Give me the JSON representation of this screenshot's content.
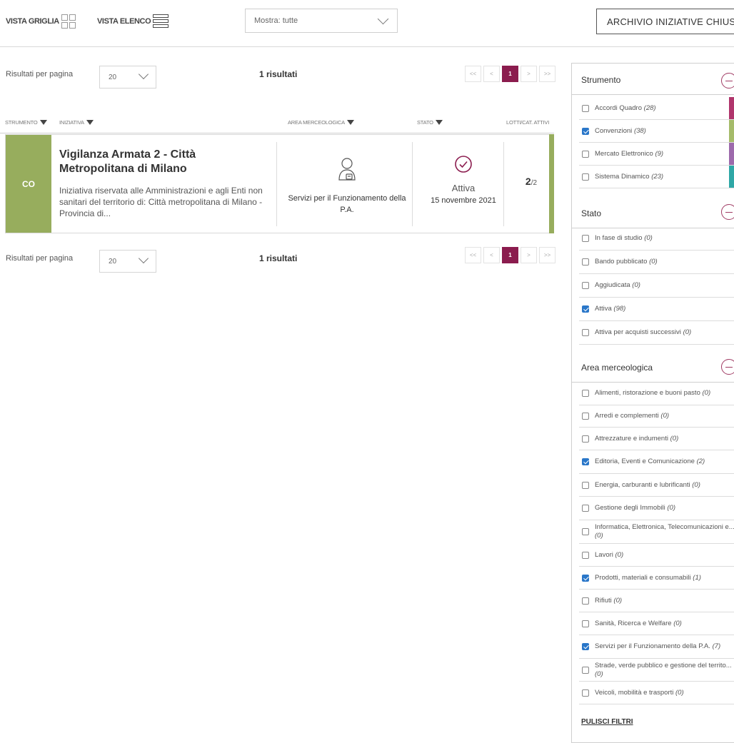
{
  "toolbar": {
    "grid_view_label": "VISTA GRIGLIA",
    "list_view_label": "VISTA ELENCO",
    "show_filter": "Mostra: tutte",
    "archive_button": "ARCHIVIO INIZIATIVE CHIUSE"
  },
  "pagination": {
    "per_page_label": "Risultati per pagina",
    "per_page_value": "20",
    "results_count": "1 risultati",
    "first": "<<",
    "prev": "<",
    "current_page": "1",
    "next": ">",
    "last": ">>"
  },
  "table_header": {
    "strumento": "STRUMENTO",
    "iniziativa": "INIZIATIVA",
    "area": "AREA MERCEOLOGICA",
    "stato": "STATO",
    "lotti": "LOTTI/CAT. ATTIVI"
  },
  "result": {
    "badge": "CO",
    "badge_color": "#97ad5d",
    "title": "Vigilanza Armata 2 - Città Metropolitana di Milano",
    "description": "Iniziativa riservata alle Amministrazioni e agli Enti non sanitari del territorio di: Città metropolitana di Milano - Provincia di...",
    "area": "Servizi per il Funzionamento della P.A.",
    "area_icon": "person-document-icon",
    "status_icon": "check-circle-icon",
    "status": "Attiva",
    "date": "15 novembre 2021",
    "lotti_active": "2",
    "lotti_total": "/2"
  },
  "sidebar": {
    "strumento": {
      "title": "Strumento",
      "items": [
        {
          "label": "Accordi Quadro",
          "count": "(28)",
          "checked": false,
          "color": "#b0356c"
        },
        {
          "label": "Convenzioni",
          "count": "(38)",
          "checked": true,
          "color": "#a5bb6a"
        },
        {
          "label": "Mercato Elettronico",
          "count": "(9)",
          "checked": false,
          "color": "#9d6aac"
        },
        {
          "label": "Sistema Dinamico",
          "count": "(23)",
          "checked": false,
          "color": "#2fa7a6"
        }
      ]
    },
    "stato": {
      "title": "Stato",
      "items": [
        {
          "label": "In fase di studio",
          "count": "(0)",
          "checked": false
        },
        {
          "label": "Bando pubblicato",
          "count": "(0)",
          "checked": false
        },
        {
          "label": "Aggiudicata",
          "count": "(0)",
          "checked": false
        },
        {
          "label": "Attiva",
          "count": "(98)",
          "checked": true
        },
        {
          "label": "Attiva per acquisti successivi",
          "count": "(0)",
          "checked": false
        }
      ]
    },
    "area": {
      "title": "Area merceologica",
      "items": [
        {
          "label": "Alimenti, ristorazione e buoni pasto",
          "count": "(0)",
          "checked": false
        },
        {
          "label": "Arredi e complementi",
          "count": "(0)",
          "checked": false
        },
        {
          "label": "Attrezzature e indumenti",
          "count": "(0)",
          "checked": false
        },
        {
          "label": "Editoria, Eventi e Comunicazione",
          "count": "(2)",
          "checked": true
        },
        {
          "label": "Energia, carburanti e lubrificanti",
          "count": "(0)",
          "checked": false
        },
        {
          "label": "Gestione degli Immobili",
          "count": "(0)",
          "checked": false
        },
        {
          "label": "Informatica, Elettronica, Telecomunicazioni e...",
          "count": "(0)",
          "checked": false
        },
        {
          "label": "Lavori",
          "count": "(0)",
          "checked": false
        },
        {
          "label": "Prodotti, materiali e consumabili",
          "count": "(1)",
          "checked": true
        },
        {
          "label": "Rifiuti",
          "count": "(0)",
          "checked": false
        },
        {
          "label": "Sanità, Ricerca e Welfare",
          "count": "(0)",
          "checked": false
        },
        {
          "label": "Servizi per il Funzionamento della P.A.",
          "count": "(7)",
          "checked": true
        },
        {
          "label": "Strade, verde pubblico e gestione del territo...",
          "count": "(0)",
          "checked": false
        },
        {
          "label": "Veicoli, mobilità e trasporti",
          "count": "(0)",
          "checked": false
        }
      ]
    },
    "clear_label": "PULISCI FILTRI"
  }
}
